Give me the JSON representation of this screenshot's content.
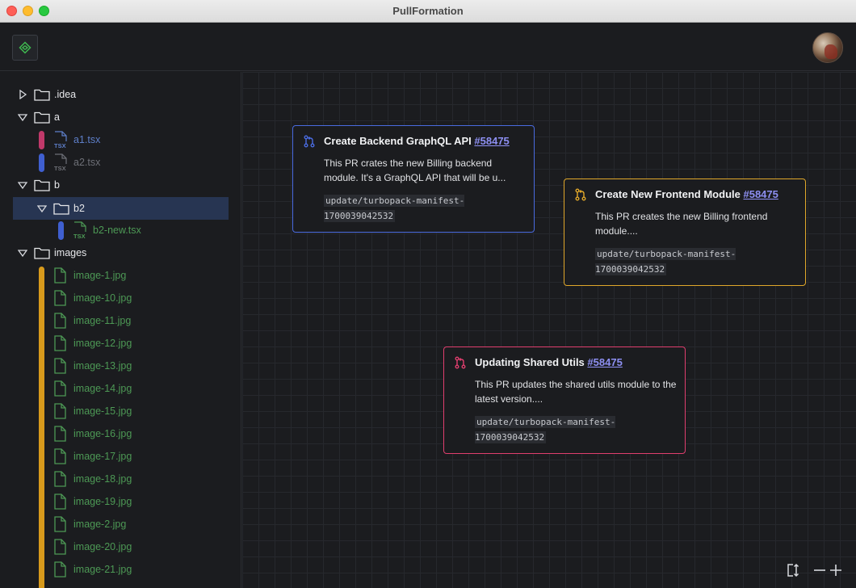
{
  "window": {
    "title": "PullFormation"
  },
  "colors": {
    "blue_card": "#4a6be0",
    "yellow_card": "#e0a72a",
    "pink_card": "#e03e6e",
    "logo_green": "#3fb950",
    "bar_pink": "#c0396a",
    "bar_blue": "#3f5fd0",
    "bar_yellow": "#d79a1c"
  },
  "header": {
    "logo_icon": "pullformation-logo-icon",
    "avatar": "user-avatar"
  },
  "tree": {
    "idea": ".idea",
    "a": "a",
    "a1": "a1.tsx",
    "a2": "a2.tsx",
    "b": "b",
    "b2": "b2",
    "b2_new": "b2-new.tsx",
    "images": "images",
    "image_files": [
      "image-1.jpg",
      "image-10.jpg",
      "image-11.jpg",
      "image-12.jpg",
      "image-13.jpg",
      "image-14.jpg",
      "image-15.jpg",
      "image-16.jpg",
      "image-17.jpg",
      "image-18.jpg",
      "image-19.jpg",
      "image-2.jpg",
      "image-20.jpg",
      "image-21.jpg"
    ],
    "tsx_badge": "TSX"
  },
  "cards": [
    {
      "title": "Create Backend GraphQL API",
      "number": "#58475",
      "description": "This PR crates the new Billing backend module. It's a GraphQL API that will be u...",
      "branch": "update/turbopack-manifest-1700039042532"
    },
    {
      "title": "Create New Frontend Module",
      "number": "#58475",
      "description": "This PR creates the new Billing frontend module....",
      "branch": "update/turbopack-manifest-1700039042532"
    },
    {
      "title": "Updating Shared Utils",
      "number": "#58475",
      "description": "This PR updates the shared utils module to the latest version....",
      "branch": "update/turbopack-manifest-1700039042532"
    }
  ],
  "controls": {
    "fit": "fit-view-icon",
    "zoom_out": "zoom-out-icon",
    "zoom_in": "zoom-in-icon"
  }
}
